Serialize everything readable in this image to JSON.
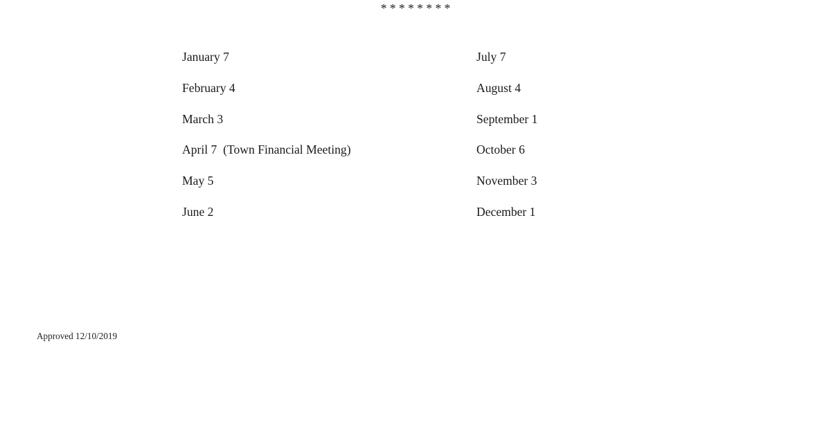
{
  "document": {
    "separator": "* * * * * * * *",
    "schedule": {
      "left_column": [
        {
          "label": "January 7"
        },
        {
          "label": "February 4"
        },
        {
          "label": "March 3"
        },
        {
          "label": "April 7  (Town Financial Meeting)"
        },
        {
          "label": "May 5"
        },
        {
          "label": "June 2"
        }
      ],
      "right_column": [
        {
          "label": "July 7"
        },
        {
          "label": "August 4"
        },
        {
          "label": "September 1"
        },
        {
          "label": "October 6"
        },
        {
          "label": "November 3"
        },
        {
          "label": "December 1"
        }
      ]
    },
    "approval": "Approved 12/10/2019"
  }
}
